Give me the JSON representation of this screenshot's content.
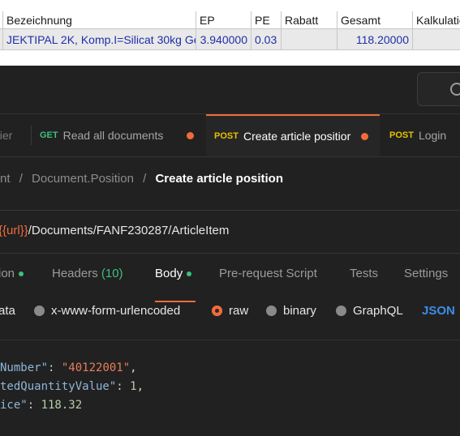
{
  "grid": {
    "headers": [
      "Bezeichnung",
      "EP",
      "PE",
      "Rabatt",
      "Gesamt",
      "Kalkulatio"
    ],
    "row": {
      "bezeichnung": "JEKTIPAL 2K, Komp.I=Silicat 30kg Ge",
      "ep": "3.940000",
      "pe": "0.03",
      "rabatt": "",
      "gesamt": "118.20000",
      "kalkulation": ""
    }
  },
  "tabs": [
    {
      "label": "aier",
      "method": "",
      "dirty": false
    },
    {
      "label": "Read all documents",
      "method": "GET",
      "method_color": "#3fbf7f",
      "dirty": true
    },
    {
      "label": "Create article positior",
      "method": "POST",
      "method_color": "#e6c200",
      "dirty": true,
      "active": true
    },
    {
      "label": "Login",
      "method": "POST",
      "method_color": "#e6c200",
      "dirty": false
    }
  ],
  "breadcrumb": {
    "part1": "nt",
    "sep": "/",
    "part2": "Document.Position",
    "current": "Create article position"
  },
  "url": {
    "variable": "{{url}}",
    "path": "/Documents/FANF230287/ArticleItem"
  },
  "request_tabs": {
    "params": "ion",
    "headers": "Headers",
    "headers_count": "(10)",
    "body": "Body",
    "prerequest": "Pre-request Script",
    "tests": "Tests",
    "settings": "Settings"
  },
  "body_options": {
    "formdata": "ata",
    "urlencoded": "x-www-form-urlencoded",
    "raw": "raw",
    "binary": "binary",
    "graphql": "GraphQL",
    "format": "JSON"
  },
  "editor": {
    "lines": [
      {
        "key": "Number\"",
        "colon": ": ",
        "value": "\"40122001\"",
        "type": "string",
        "trail": ","
      },
      {
        "key": "tedQuantityValue\"",
        "colon": ": ",
        "value": "1",
        "type": "number",
        "trail": ","
      },
      {
        "key": "ice\"",
        "colon": ": ",
        "value": "118.32",
        "type": "number",
        "trail": ""
      }
    ]
  },
  "colors": {
    "accent": "#f26b3a",
    "background": "#212121",
    "grid_text": "#1f2fa8",
    "json_blue": "#3a8ee6"
  }
}
